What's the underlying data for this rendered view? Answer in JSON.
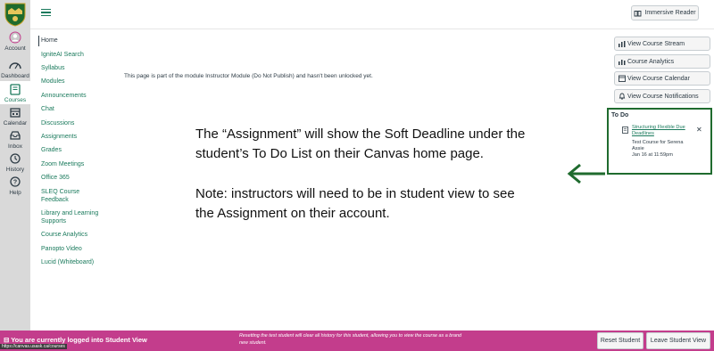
{
  "global_nav": {
    "items": [
      {
        "label": "Account",
        "icon": "account-avatar-icon"
      },
      {
        "label": "Dashboard",
        "icon": "dashboard-icon"
      },
      {
        "label": "Courses",
        "icon": "courses-book-icon"
      },
      {
        "label": "Calendar",
        "icon": "calendar-icon"
      },
      {
        "label": "Inbox",
        "icon": "inbox-icon"
      },
      {
        "label": "History",
        "icon": "history-clock-icon"
      },
      {
        "label": "Help",
        "icon": "help-icon"
      }
    ]
  },
  "header": {
    "immersive_reader": "Immersive Reader"
  },
  "course_nav": {
    "items": [
      "Home",
      "IgniteAI Search",
      "Syllabus",
      "Modules",
      "Announcements",
      "Chat",
      "Discussions",
      "Assignments",
      "Grades",
      "Zoom Meetings",
      "Office 365",
      "SLEQ Course",
      "Feedback",
      "Library and Learning",
      "Supports",
      "Course Analytics",
      "Panopto Video",
      "Lucid (Whiteboard)"
    ]
  },
  "main": {
    "lock_prefix": "This page is part of the module ",
    "lock_module": "Instructor Module (Do Not Publish)",
    "lock_suffix": " and hasn't been unlocked yet."
  },
  "sidebar": {
    "buttons": [
      "View Course Stream",
      "Course Analytics",
      "View Course Calendar",
      "View Course Notifications"
    ],
    "todo_title": "To Do",
    "todo_item": {
      "link": "Structuring Flexible Due Deadlines",
      "course": "Test Course for Serena Assie",
      "date": "Jan 16 at 11:59pm"
    }
  },
  "annotation": {
    "line1": "The “Assignment” will show the Soft Deadline under the",
    "line2": "student’s To Do List on their Canvas home page.",
    "line3": "Note: instructors will need to be in student view to see",
    "line4": "the Assignment on their account."
  },
  "footer": {
    "left": "You are currently logged into Student View",
    "url": "https://canvas.usask.ca/courses",
    "mid": "Resetting the test student will clear all history for this student, allowing you to view the course as a brand new student.",
    "reset": "Reset Student",
    "leave": "Leave Student View"
  },
  "colors": {
    "accent": "#1a7a5c",
    "todo_border": "#1f6b2e",
    "footer": "#c33d8c"
  }
}
